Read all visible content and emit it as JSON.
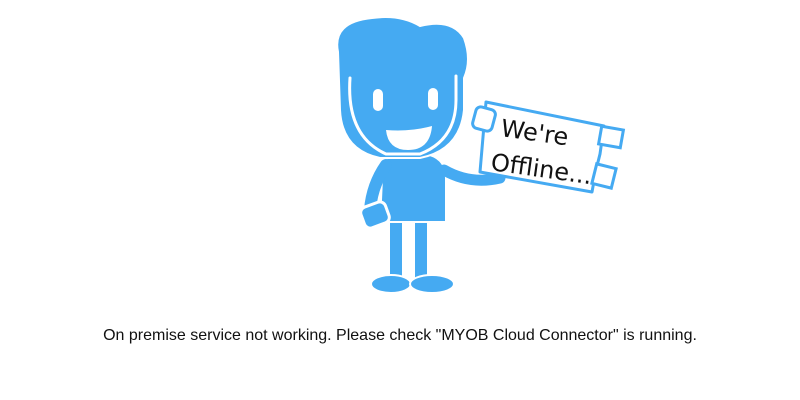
{
  "illustration": {
    "sign_line_1": "We're",
    "sign_line_2": "Offline..."
  },
  "message": {
    "text": "On premise service not working. Please check \"MYOB Cloud Connector\" is running."
  },
  "colors": {
    "character_blue": "#45aaf2",
    "outline_white": "#ffffff",
    "sign_border": "#45aaf2",
    "text": "#111111"
  }
}
